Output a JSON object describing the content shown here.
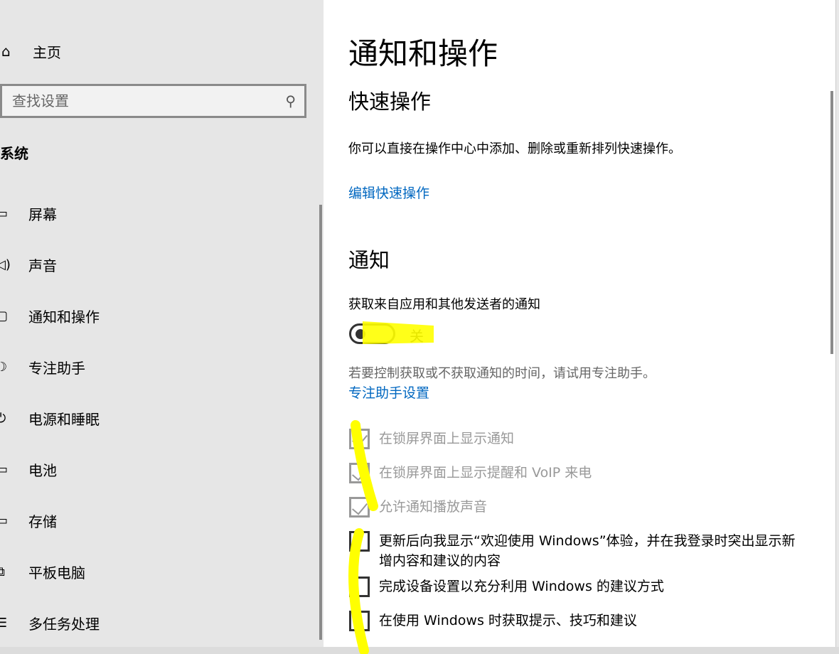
{
  "sidebar": {
    "home": "主页",
    "search_placeholder": "查找设置",
    "section": "系统",
    "items": [
      {
        "label": "屏幕",
        "icon": "monitor-icon"
      },
      {
        "label": "声音",
        "icon": "speaker-icon"
      },
      {
        "label": "通知和操作",
        "icon": "message-icon"
      },
      {
        "label": "专注助手",
        "icon": "moon-icon"
      },
      {
        "label": "电源和睡眠",
        "icon": "power-icon"
      },
      {
        "label": "电池",
        "icon": "battery-icon"
      },
      {
        "label": "存储",
        "icon": "storage-icon"
      },
      {
        "label": "平板电脑",
        "icon": "tablet-icon"
      },
      {
        "label": "多任务处理",
        "icon": "multitask-icon"
      }
    ]
  },
  "main": {
    "title": "通知和操作",
    "quick_heading": "快速操作",
    "quick_desc": "你可以直接在操作中心中添加、删除或重新排列快速操作。",
    "quick_link": "编辑快速操作",
    "notif_heading": "通知",
    "toggle_label": "获取来自应用和其他发送者的通知",
    "toggle_state": "关",
    "toggle_on": false,
    "help_text": "若要控制获取或不获取通知的时间，请试用专注助手。",
    "focus_link": "专注助手设置",
    "checkboxes": [
      {
        "label": "在锁屏界面上显示通知",
        "checked": true,
        "disabled": true
      },
      {
        "label": "在锁屏界面上显示提醒和 VoIP 来电",
        "checked": true,
        "disabled": true
      },
      {
        "label": "允许通知播放声音",
        "checked": true,
        "disabled": true
      },
      {
        "label": "更新后向我显示“欢迎使用 Windows”体验，并在我登录时突出显示新增内容和建议的内容",
        "checked": false,
        "disabled": false
      },
      {
        "label": "完成设备设置以充分利用 Windows 的建议方式",
        "checked": false,
        "disabled": false
      },
      {
        "label": "在使用 Windows 时获取提示、技巧和建议",
        "checked": false,
        "disabled": false
      }
    ]
  },
  "colors": {
    "link": "#0067c0",
    "highlight": "#ffff00",
    "sidebar_bg": "#e6e6e6"
  }
}
